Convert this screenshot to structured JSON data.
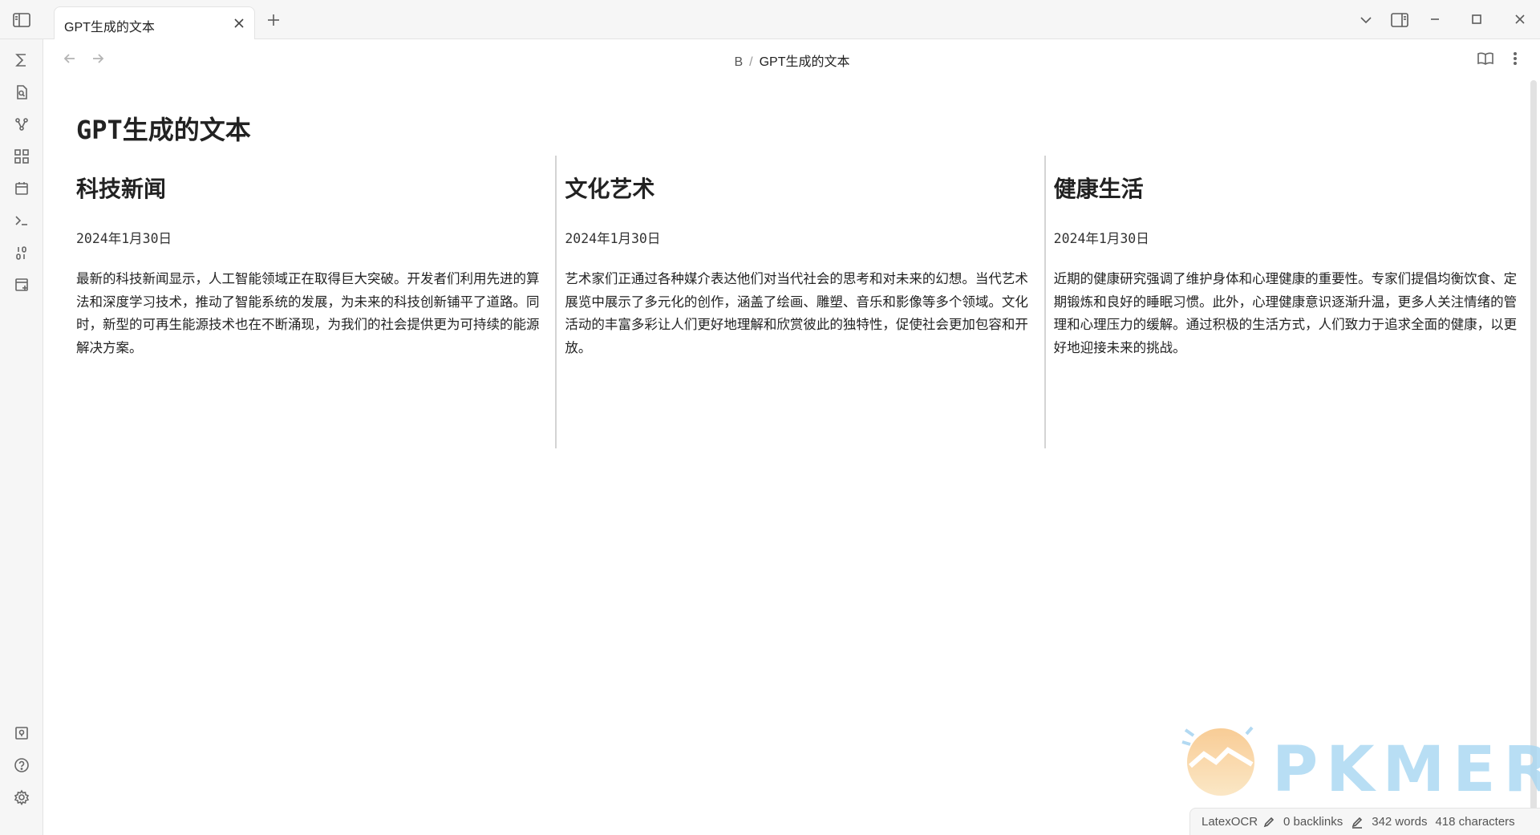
{
  "window": {
    "tab_title": "GPT生成的文本"
  },
  "breadcrumb": {
    "parent": "B",
    "separator": "/",
    "current": "GPT生成的文本"
  },
  "note": {
    "title": "GPT生成的文本",
    "columns": [
      {
        "heading": "科技新闻",
        "date": "2024年1月30日",
        "body": "最新的科技新闻显示，人工智能领域正在取得巨大突破。开发者们利用先进的算法和深度学习技术，推动了智能系统的发展，为未来的科技创新铺平了道路。同时，新型的可再生能源技术也在不断涌现，为我们的社会提供更为可持续的能源解决方案。"
      },
      {
        "heading": "文化艺术",
        "date": "2024年1月30日",
        "body": "艺术家们正通过各种媒介表达他们对当代社会的思考和对未来的幻想。当代艺术展览中展示了多元化的创作，涵盖了绘画、雕塑、音乐和影像等多个领域。文化活动的丰富多彩让人们更好地理解和欣赏彼此的独特性，促使社会更加包容和开放。"
      },
      {
        "heading": "健康生活",
        "date": "2024年1月30日",
        "body": "近期的健康研究强调了维护身体和心理健康的重要性。专家们提倡均衡饮食、定期锻炼和良好的睡眠习惯。此外，心理健康意识逐渐升温，更多人关注情绪的管理和心理压力的缓解。通过积极的生活方式，人们致力于追求全面的健康，以更好地迎接未来的挑战。"
      }
    ]
  },
  "statusbar": {
    "plugin": "LatexOCR",
    "backlinks": "0 backlinks",
    "words": "342 words",
    "characters": "418 characters"
  },
  "watermark": {
    "text": "PKMER"
  },
  "icons": {
    "ribbon": [
      "sigma-icon",
      "file-search-icon",
      "graph-icon",
      "blocks-icon",
      "calendar-icon",
      "terminal-icon",
      "binary-icon",
      "list-plus-icon",
      "vault-icon",
      "help-icon",
      "settings-icon"
    ]
  }
}
